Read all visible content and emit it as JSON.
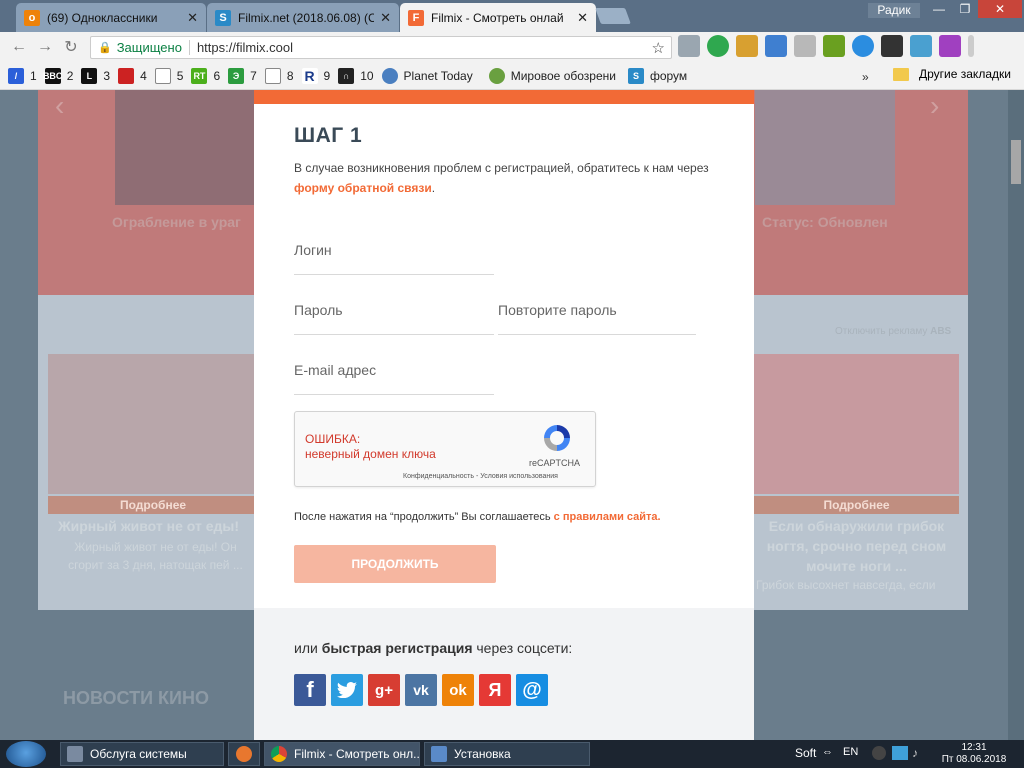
{
  "browser": {
    "tabs": [
      {
        "title": "(69) Одноклассники",
        "favicon_color": "#ee8208"
      },
      {
        "title": "Filmix.net (2018.06.08) (C",
        "favicon_color": "#2a8ac7"
      },
      {
        "title": "Filmix - Смотреть онлай",
        "favicon_color": "#f26a36"
      }
    ],
    "profile": "Радик",
    "secure_label": "Защищено",
    "url": "https://filmix.cool",
    "bookmarks": [
      {
        "label": "1",
        "icon": "slash-icon",
        "color": "#2b5fd9"
      },
      {
        "label": "2",
        "icon": "bbc-icon",
        "color": "#111111"
      },
      {
        "label": "3",
        "icon": "l-icon",
        "color": "#111111"
      },
      {
        "label": "4",
        "icon": "flag-icon",
        "color": "#cc2222"
      },
      {
        "label": "5",
        "icon": "page-icon",
        "color": "#888888"
      },
      {
        "label": "6",
        "icon": "rt-icon",
        "color": "#4caf1c"
      },
      {
        "label": "7",
        "icon": "e-icon",
        "color": "#2c9c3f"
      },
      {
        "label": "8",
        "icon": "page-icon",
        "color": "#888888"
      },
      {
        "label": "9",
        "icon": "r-icon",
        "color": "#1c3c8c"
      },
      {
        "label": "10",
        "icon": "n-icon",
        "color": "#222222"
      },
      {
        "label": "Planet Today",
        "icon": "globe-icon",
        "color": "#4a7fc0"
      },
      {
        "label": "Мировое обозрени",
        "icon": "globe-icon",
        "color": "#6aa040"
      },
      {
        "label": "форум",
        "icon": "filmix-icon",
        "color": "#2a8ac7"
      }
    ],
    "bookmarks_more": "»",
    "other_bookmarks": "Другие закладки"
  },
  "background": {
    "left_title": "Ограбление в ураг",
    "right_title": "Статус: Обновлен",
    "ad_note": "Отключить рекламу",
    "ad_badge": "ABS",
    "more_label": "Подробнее",
    "left_card_title": "Жирный живот не от еды!",
    "left_card_sub": "Жирный живот не от еды! Он сгорит за 3 дня, натощак пей ...",
    "right_card_title": "Если обнаружили грибок ногтя, срочно перед сном мочите ноги ...",
    "right_card_sub": "Грибок высохнет навсегда, если",
    "news_heading": "НОВОСТИ КИНО"
  },
  "form": {
    "step_title": "ШАГ 1",
    "intro_text": "В случае возникновения проблем с регистрацией, обратитесь к нам через",
    "intro_link": "форму обратной связи",
    "intro_end": ".",
    "login_placeholder": "Логин",
    "password_placeholder": "Пароль",
    "password_repeat_placeholder": "Повторите пароль",
    "email_placeholder": "E-mail адрес",
    "recaptcha_error_line1": "ОШИБКА:",
    "recaptcha_error_line2": "неверный домен ключа",
    "recaptcha_brand": "reCAPTCHA",
    "recaptcha_privacy": "Конфиденциальность - Условия использования",
    "terms_text": "После нажатия на “продолжить” Вы соглашаетесь",
    "terms_link": "с правилами сайта.",
    "submit_label": "ПРОДОЛЖИТЬ",
    "social_prefix": "или",
    "social_bold": "быстрая регистрация",
    "social_suffix": "через соцсети:",
    "social_buttons": [
      {
        "name": "facebook",
        "glyph": "f",
        "color": "#3b5998"
      },
      {
        "name": "twitter",
        "glyph": "t",
        "color": "#2b9de0"
      },
      {
        "name": "google-plus",
        "glyph": "g+",
        "color": "#d73d32"
      },
      {
        "name": "vkontakte",
        "glyph": "vk",
        "color": "#4c75a3"
      },
      {
        "name": "odnoklassniki",
        "glyph": "ok",
        "color": "#ee8208"
      },
      {
        "name": "yandex",
        "glyph": "Я",
        "color": "#e53935"
      },
      {
        "name": "mailru",
        "glyph": "@",
        "color": "#168de2"
      }
    ]
  },
  "taskbar": {
    "items": [
      {
        "label": "Обслуга системы"
      },
      {
        "label": ""
      },
      {
        "label": "Filmix - Смотреть онл..."
      },
      {
        "label": "Установка"
      }
    ],
    "tray_soft": "Soft",
    "tray_lang": "EN",
    "time": "12:31",
    "date": "Пт 08.06.2018"
  }
}
